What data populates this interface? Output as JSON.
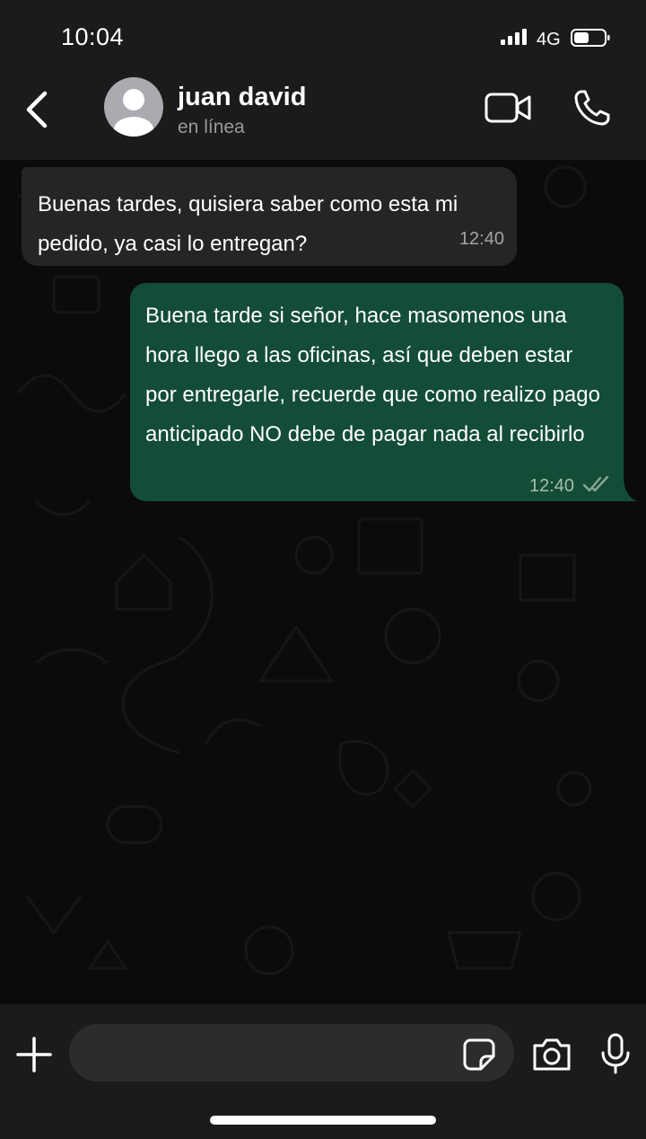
{
  "status_bar": {
    "time": "10:04",
    "network": "4G",
    "icons": [
      "signal-icon",
      "battery-icon"
    ]
  },
  "header": {
    "contact_name": "juan david",
    "contact_status": "en línea",
    "icons": [
      "back-icon",
      "avatar-placeholder-icon",
      "video-call-icon",
      "phone-icon"
    ]
  },
  "messages": [
    {
      "direction": "incoming",
      "text": "Buenas tardes, quisiera saber como esta mi pedido, ya casi lo entregan?",
      "time": "12:40"
    },
    {
      "direction": "outgoing",
      "text": "Buena tarde si señor, hace masomenos una hora llego a las oficinas, así que deben estar por entregarle, recuerde que como realizo pago anticipado NO debe de pagar nada al recibirlo",
      "time": "12:40",
      "status_icon": "double-check-icon"
    }
  ],
  "input_bar": {
    "placeholder": "",
    "icons": [
      "plus-icon",
      "sticker-icon",
      "camera-icon",
      "microphone-icon"
    ]
  },
  "colors": {
    "bar_background": "#1b1b1b",
    "chat_background": "#0b0b0b",
    "incoming_bubble": "#242626",
    "outgoing_bubble": "#144d37",
    "secondary_text": "#9a9a9a"
  }
}
